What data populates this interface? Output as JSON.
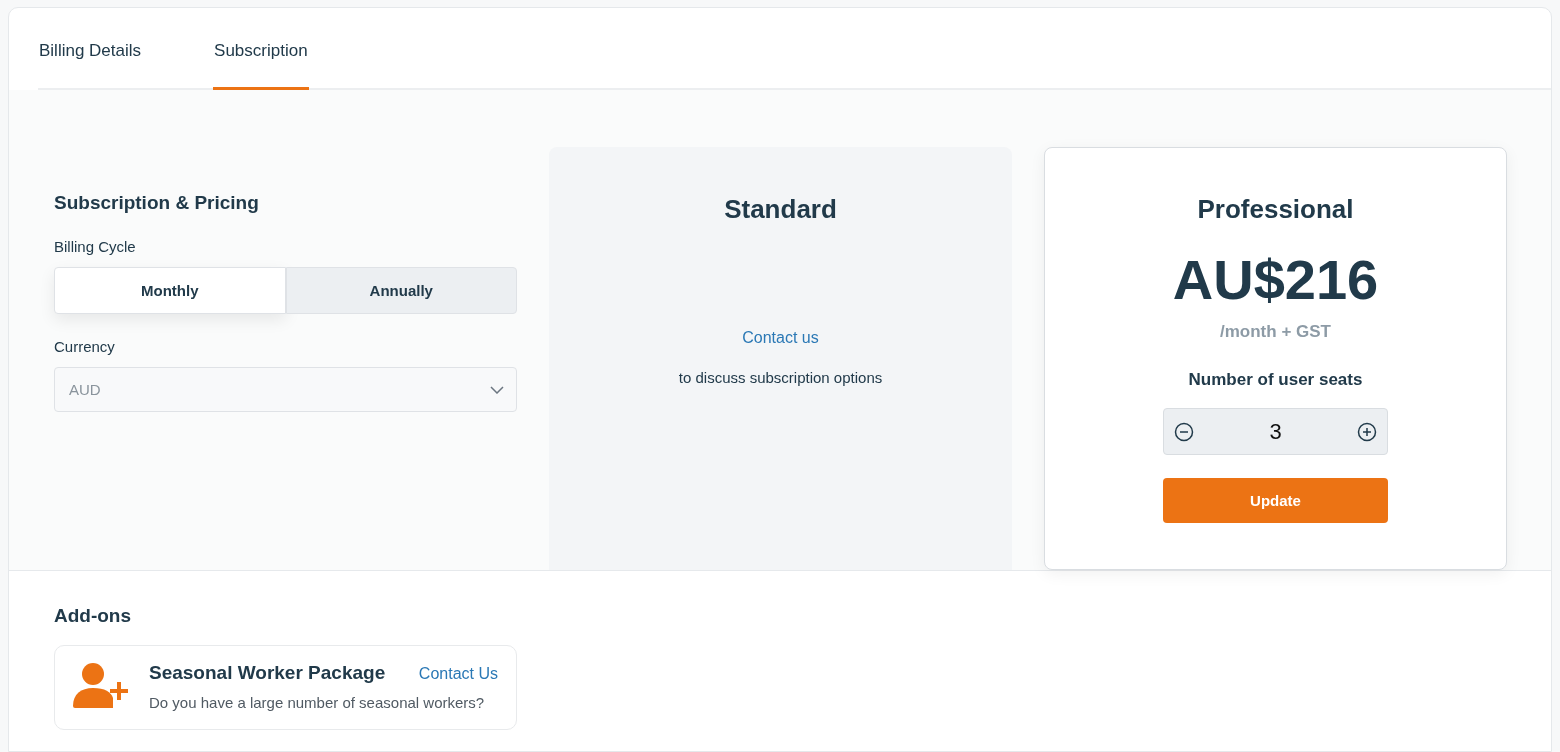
{
  "tabs": [
    {
      "label": "Billing Details",
      "selected": false
    },
    {
      "label": "Subscription",
      "selected": true
    }
  ],
  "pricing": {
    "title": "Subscription & Pricing",
    "billing_cycle": {
      "label": "Billing Cycle",
      "options": [
        {
          "label": "Monthly",
          "selected": true
        },
        {
          "label": "Annually",
          "selected": false
        }
      ]
    },
    "currency": {
      "label": "Currency",
      "value": "AUD"
    }
  },
  "plans": [
    {
      "kind": "contact",
      "name": "Standard",
      "selected": false,
      "link": "Contact us",
      "note": "to discuss subscription options"
    },
    {
      "kind": "priced",
      "name": "Professional",
      "selected": true,
      "price": "AU$216",
      "period": "/month + GST",
      "seats_label": "Number of user seats",
      "seats": "3",
      "button": "Update"
    }
  ],
  "addons": {
    "title": "Add-ons",
    "items": [
      {
        "name": "Seasonal Worker Package",
        "link": "Contact Us",
        "description": "Do you have a large number of seasonal workers?"
      }
    ]
  }
}
